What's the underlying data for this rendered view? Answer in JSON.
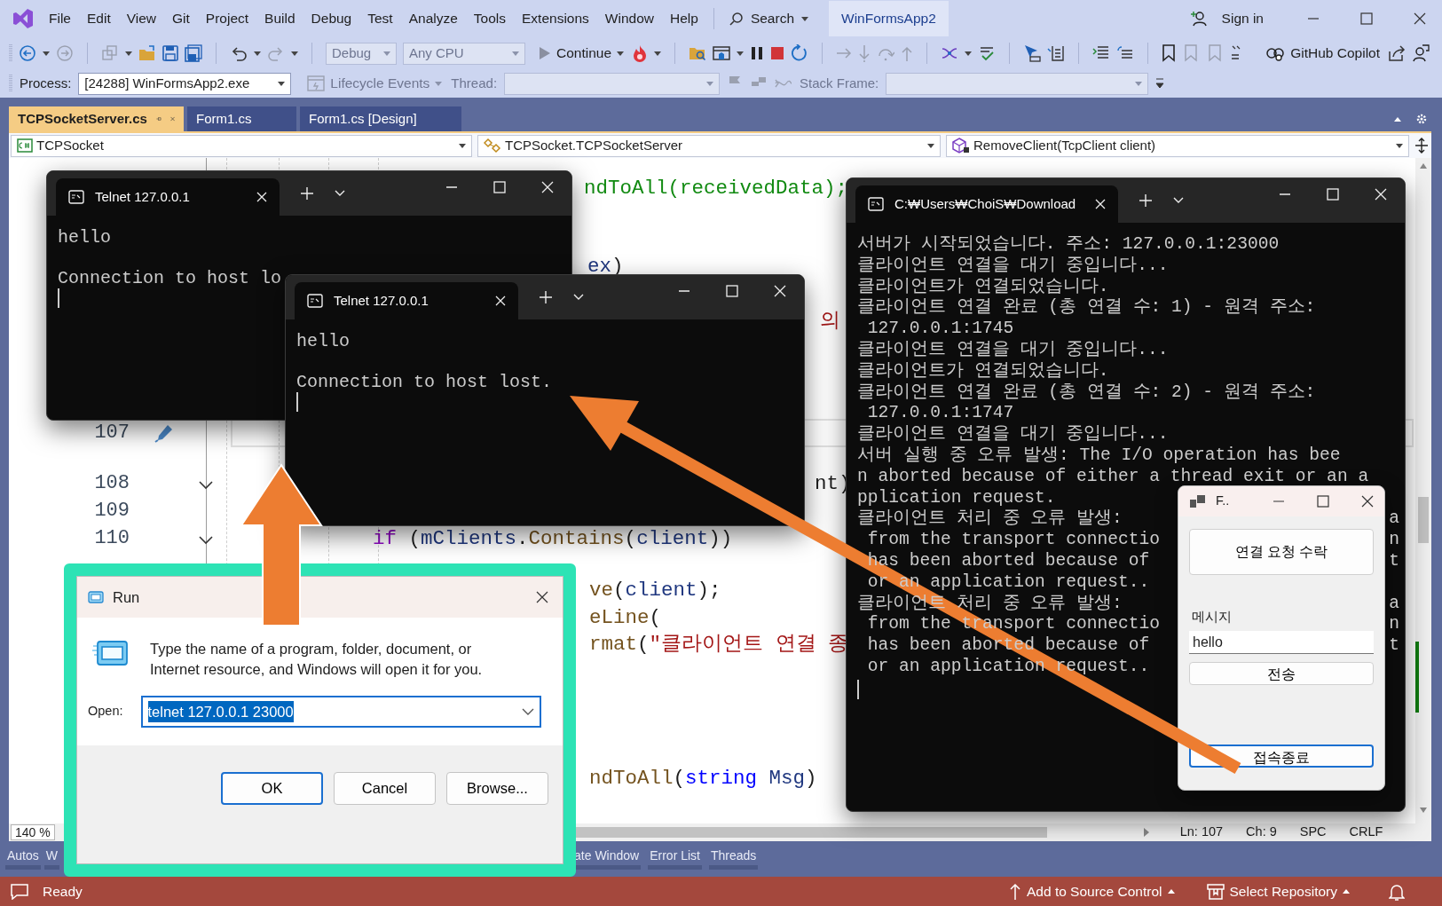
{
  "title_bar": {
    "menu": [
      "File",
      "Edit",
      "View",
      "Git",
      "Project",
      "Build",
      "Debug",
      "Test",
      "Analyze",
      "Tools",
      "Extensions",
      "Window",
      "Help"
    ],
    "search": "Search",
    "solution": "WinFormsApp2",
    "sign_in": "Sign in"
  },
  "toolbar": {
    "configuration": {
      "text": "Debug",
      "disabled": true
    },
    "platform": {
      "text": "Any CPU",
      "disabled": true
    },
    "continue": "Continue",
    "copilot": "GitHub Copilot"
  },
  "debug_location": {
    "process_label": "Process:",
    "process": "[24288] WinFormsApp2.exe",
    "lifecycle": {
      "text": "Lifecycle Events",
      "disabled": true
    },
    "thread_label": "Thread:",
    "stack_frame_label": "Stack Frame:"
  },
  "document_tabs": [
    {
      "label": "TCPSocketServer.cs",
      "selected": true
    },
    {
      "label": "Form1.cs",
      "selected": false
    },
    {
      "label": "Form1.cs [Design]",
      "selected": false
    }
  ],
  "navigation_bar": [
    "TCPSocket",
    "TCPSocket.TCPSocketServer",
    "RemoveClient(TcpClient client)"
  ],
  "editor": {
    "lines": [
      {
        "code": [
          {
            "text": "ndToAll(receivedData);",
            "kind": "green"
          }
        ],
        "current": false
      },
      {
        "code": [
          {
            "text": "ex",
            "kind": "variable"
          },
          {
            "text": ")",
            "kind": "plain"
          }
        ],
        "current": false
      },
      {
        "code": [
          {
            "text": "의",
            "kind": "string"
          }
        ],
        "current": false
      },
      {
        "number": "107",
        "current": true
      },
      {
        "number": "108",
        "code": [
          {
            "text": "nt)",
            "kind": "plain"
          }
        ],
        "current": false
      },
      {
        "number": "109",
        "current": false
      },
      {
        "number": "110",
        "code": [
          {
            "text": "if",
            "kind": "keyword"
          },
          {
            "text": " (",
            "kind": "plain"
          },
          {
            "text": "mClients",
            "kind": "variable"
          },
          {
            "text": ".",
            "kind": "plain"
          },
          {
            "text": "Contains",
            "kind": "method"
          },
          {
            "text": "(",
            "kind": "plain"
          },
          {
            "text": "client",
            "kind": "variable"
          },
          {
            "text": "))",
            "kind": "plain"
          }
        ],
        "current": false
      },
      {
        "code": [
          {
            "text": "ve",
            "kind": "method"
          },
          {
            "text": "(",
            "kind": "plain"
          },
          {
            "text": "client",
            "kind": "variable"
          },
          {
            "text": ");",
            "kind": "plain"
          }
        ],
        "current": false
      },
      {
        "code": [
          {
            "text": "eLine",
            "kind": "method"
          },
          {
            "text": "(",
            "kind": "plain"
          }
        ],
        "current": false
      },
      {
        "code": [
          {
            "text": "rmat",
            "kind": "method"
          },
          {
            "text": "(",
            "kind": "plain"
          },
          {
            "text": "\"클라이언트 연결 종",
            "kind": "string"
          }
        ],
        "current": false
      },
      {
        "code": [
          {
            "text": "ndToAll",
            "kind": "method"
          },
          {
            "text": "(",
            "kind": "plain"
          },
          {
            "text": "string",
            "kind": "type"
          },
          {
            "text": " Msg",
            "kind": "variable"
          },
          {
            "text": ")",
            "kind": "plain"
          }
        ],
        "current": false
      }
    ],
    "zoom": "140 %",
    "position": [
      "Ln: 107",
      "Ch: 9",
      "SPC",
      "CRLF"
    ]
  },
  "tool_tabs": [
    "Autos",
    "W",
    "ate Window",
    "Error List",
    "Threads"
  ],
  "status_bar": {
    "state": "Ready",
    "add_to_source_control": "Add to Source Control",
    "select_repository": "Select Repository"
  },
  "telnet_windows": [
    {
      "title": "Telnet 127.0.0.1",
      "lines": [
        {
          "text": "hello",
          "blank_after": true
        },
        {
          "text": "Connection to host lo",
          "blank_after": false
        }
      ]
    },
    {
      "title": "Telnet 127.0.0.1",
      "lines": [
        {
          "text": "hello",
          "blank_after": true
        },
        {
          "text": "Connection to host lost.",
          "blank_after": false
        }
      ]
    }
  ],
  "console_window": {
    "title": "C:₩Users₩ChoiS₩Download",
    "lines": [
      {
        "text": "서버가 시작되었습니다. 주소: 127.0.0.1:23000"
      },
      {
        "text": "클라이언트 연결을 대기 중입니다..."
      },
      {
        "text": "클라이언트가 연결되었습니다."
      },
      {
        "text": "클라이언트 연결 완료 (총 연결 수: 1) - 원격 주소:"
      },
      {
        "text": " 127.0.0.1:1745"
      },
      {
        "text": "클라이언트 연결을 대기 중입니다..."
      },
      {
        "text": "클라이언트가 연결되었습니다."
      },
      {
        "text": "클라이언트 연결 완료 (총 연결 수: 2) - 원격 주소:"
      },
      {
        "text": " 127.0.0.1:1747"
      },
      {
        "text": "클라이언트 연결을 대기 중입니다..."
      },
      {
        "text": "서버 실행 중 오류 발생: The I/O operation has bee"
      },
      {
        "text": "n aborted because of either a thread exit or an a"
      },
      {
        "text": "pplication request."
      },
      {
        "text": "클라이언트 처리 중 오류 발생:",
        "tail": "a"
      },
      {
        "text": " from the transport connectio",
        "tail": "n"
      },
      {
        "text": " has been aborted because of",
        "tail": "t"
      },
      {
        "text": " or an application request.."
      },
      {
        "text": "클라이언트 처리 중 오류 발생:",
        "tail": "a"
      },
      {
        "text": " from the transport connectio",
        "tail": "n"
      },
      {
        "text": " has been aborted because of",
        "tail": "t"
      },
      {
        "text": " or an application request.."
      }
    ]
  },
  "form_window": {
    "title": "F..",
    "accept_button": "연결 요청 수락",
    "message_label": "메시지",
    "message_value": "hello",
    "send_button": "전송",
    "disconnect_button": "접속종료"
  },
  "run_dialog": {
    "title": "Run",
    "description": "Type the name of a program, folder, document, or Internet resource, and Windows will open it for you.",
    "open_label": "Open:",
    "open_value": "telnet 127.0.0.1 23000",
    "buttons": [
      {
        "label": "OK",
        "default": true
      },
      {
        "label": "Cancel",
        "default": false
      },
      {
        "label": "Browse...",
        "default": false
      }
    ]
  }
}
